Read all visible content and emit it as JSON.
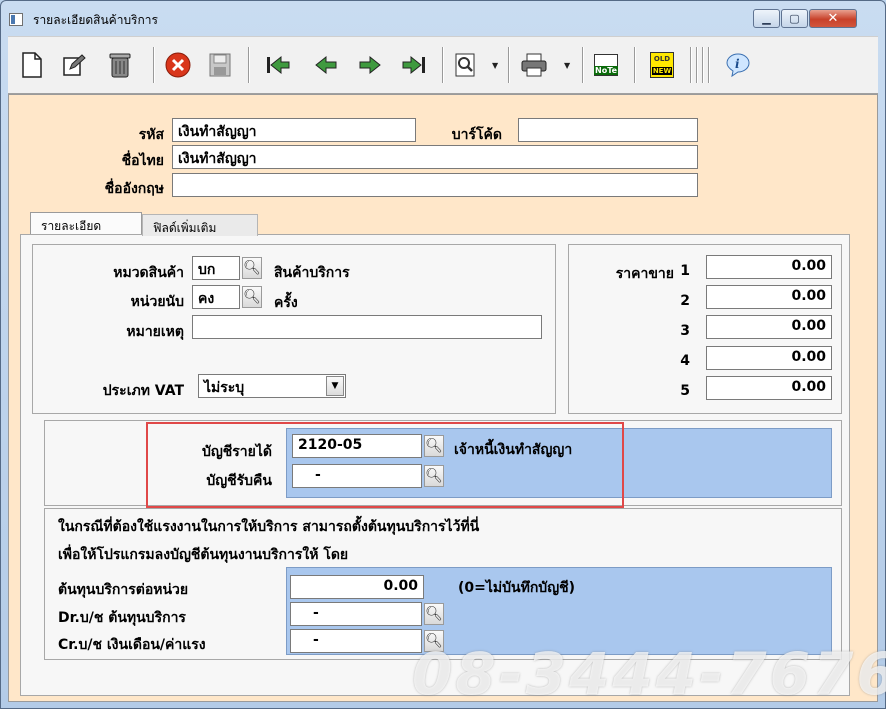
{
  "window": {
    "title": "รายละเอียดสินค้าบริการ",
    "controls": {
      "minimize": "▁",
      "maximize": "▢",
      "close": "✕"
    }
  },
  "toolbar": {
    "icons": [
      "new-document-icon",
      "edit-icon",
      "trash-icon",
      "cancel-icon",
      "save-icon",
      "first-record-icon",
      "previous-record-icon",
      "next-record-icon",
      "last-record-icon",
      "search-icon",
      "print-icon",
      "note-icon",
      "old-new-icon",
      "info-icon"
    ],
    "note_label": "NoTe",
    "old_label": "OLD",
    "new_label": "NEW"
  },
  "header": {
    "code_label": "รหัส",
    "code_value": "เงินทำสัญญา",
    "barcode_label": "บาร์โค้ด",
    "barcode_value": "",
    "thai_name_label": "ชื่อไทย",
    "thai_name_value": "เงินทำสัญญา",
    "english_name_label": "ชื่ออังกฤษ",
    "english_name_value": ""
  },
  "tabs": [
    {
      "label": "รายละเอียด",
      "active": true
    },
    {
      "label": "ฟิลด์เพิ่มเติม",
      "active": false
    }
  ],
  "details": {
    "category_label": "หมวดสินค้า",
    "category_code": "บก",
    "category_name": "สินค้าบริการ",
    "unit_label": "หน่วยนับ",
    "unit_code": "คง",
    "unit_name": "ครั้ง",
    "note_label": "หมายเหตุ",
    "note_value": "",
    "vat_label": "ประเภท VAT",
    "vat_value": "ไม่ระบุ"
  },
  "prices": {
    "label": "ราคาขาย",
    "rows": [
      {
        "index": "1",
        "value": "0.00"
      },
      {
        "index": "2",
        "value": "0.00"
      },
      {
        "index": "3",
        "value": "0.00"
      },
      {
        "index": "4",
        "value": "0.00"
      },
      {
        "index": "5",
        "value": "0.00"
      }
    ]
  },
  "accounts": {
    "income_label": "บัญชีรายได้",
    "income_code": "2120-05",
    "income_name": "เจ้าหนี้เงินทำสัญญา",
    "refund_label": "บัญชีรับคืน",
    "refund_code": "-"
  },
  "cost": {
    "intro_line1": "ในกรณีที่ต้องใช้แรงงานในการให้บริการ สามารถตั้งต้นทุนบริการไว้ที่นี่",
    "intro_line2": "เพื่อให้โปรแกรมลงบัญชีต้นทุนงานบริการให้ โดย",
    "unit_cost_label": "ต้นทุนบริการต่อหน่วย",
    "unit_cost_value": "0.00",
    "unit_cost_note": "(0=ไม่บันทึกบัญชี)",
    "dr_label": "Dr.บ/ช ต้นทุนบริการ",
    "dr_value": "-",
    "cr_label": "Cr.บ/ช เงินเดือน/ค่าแรง",
    "cr_value": "-"
  },
  "watermark": "08-3444-7676",
  "colors": {
    "form_background": "#ffe7c9",
    "panel_blue": "#a9c7ee",
    "highlight_red": "#e04848"
  }
}
